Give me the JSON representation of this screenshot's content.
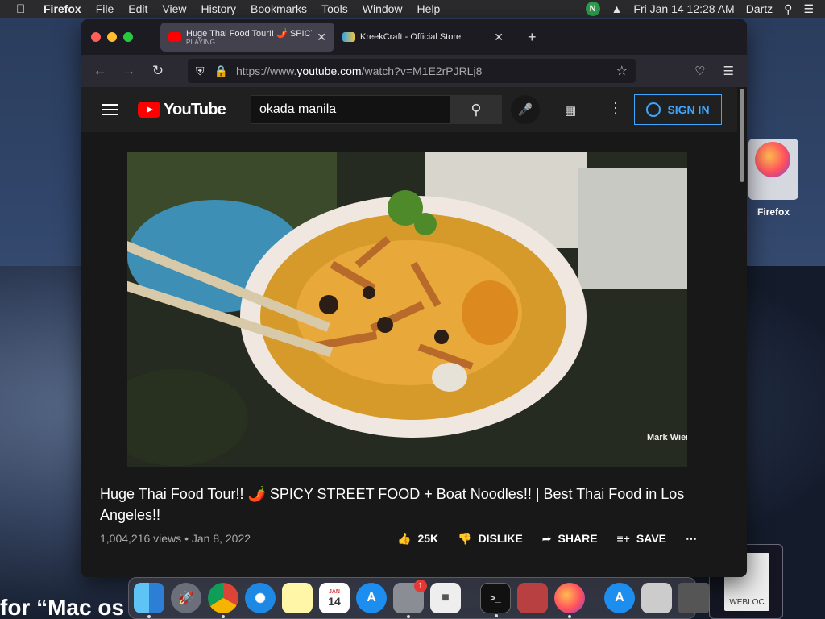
{
  "menubar": {
    "app": "Firefox",
    "items": [
      "File",
      "Edit",
      "View",
      "History",
      "Bookmarks",
      "Tools",
      "Window",
      "Help"
    ],
    "clock": "Fri Jan 14  12:28 AM",
    "user": "Dartz",
    "status_badge": "N"
  },
  "browser": {
    "tabs": [
      {
        "title": "Huge Thai Food Tour!! 🌶️ SPICY",
        "subtitle": "PLAYING",
        "active": true
      },
      {
        "title": "KreekCraft - Official Store",
        "active": false
      }
    ],
    "url_prefix": "https://www.",
    "url_domain": "youtube.com",
    "url_suffix": "/watch?v=M1E2rPJRLj8"
  },
  "youtube": {
    "logo_text": "YouTube",
    "search_value": "okada manila",
    "sign_in_label": "SIGN IN",
    "video": {
      "title": "Huge Thai Food Tour!! 🌶️ SPICY STREET FOOD + Boat Noodles!! | Best Thai Food in Los Angeles!!",
      "meta": "1,004,216 views • Jan 8, 2022",
      "watermark": "Mark Wiens"
    },
    "actions": {
      "like": "25K",
      "dislike": "DISLIKE",
      "share": "SHARE",
      "save": "SAVE"
    }
  },
  "desktop": {
    "icon_label": "Firefox",
    "webloc_label": "WEBLOC",
    "background_text": "for “Mac os"
  },
  "dock": {
    "calendar_month": "JAN",
    "calendar_day": "14",
    "settings_badge": "1"
  },
  "colors": {
    "youtube_red": "#ff0000",
    "signin_blue": "#3ea6ff",
    "yt_bg": "#181818"
  }
}
